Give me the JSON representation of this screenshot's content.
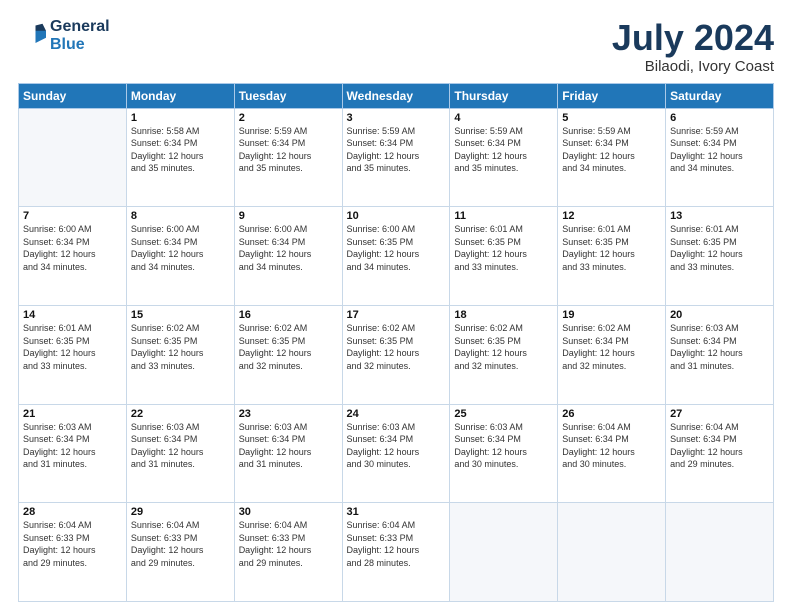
{
  "header": {
    "logo_line1": "General",
    "logo_line2": "Blue",
    "title": "July 2024",
    "subtitle": "Bilaodi, Ivory Coast"
  },
  "days_of_week": [
    "Sunday",
    "Monday",
    "Tuesday",
    "Wednesday",
    "Thursday",
    "Friday",
    "Saturday"
  ],
  "weeks": [
    [
      {
        "day": "",
        "info": ""
      },
      {
        "day": "1",
        "info": "Sunrise: 5:58 AM\nSunset: 6:34 PM\nDaylight: 12 hours\nand 35 minutes."
      },
      {
        "day": "2",
        "info": "Sunrise: 5:59 AM\nSunset: 6:34 PM\nDaylight: 12 hours\nand 35 minutes."
      },
      {
        "day": "3",
        "info": "Sunrise: 5:59 AM\nSunset: 6:34 PM\nDaylight: 12 hours\nand 35 minutes."
      },
      {
        "day": "4",
        "info": "Sunrise: 5:59 AM\nSunset: 6:34 PM\nDaylight: 12 hours\nand 35 minutes."
      },
      {
        "day": "5",
        "info": "Sunrise: 5:59 AM\nSunset: 6:34 PM\nDaylight: 12 hours\nand 34 minutes."
      },
      {
        "day": "6",
        "info": "Sunrise: 5:59 AM\nSunset: 6:34 PM\nDaylight: 12 hours\nand 34 minutes."
      }
    ],
    [
      {
        "day": "7",
        "info": "Sunrise: 6:00 AM\nSunset: 6:34 PM\nDaylight: 12 hours\nand 34 minutes."
      },
      {
        "day": "8",
        "info": "Sunrise: 6:00 AM\nSunset: 6:34 PM\nDaylight: 12 hours\nand 34 minutes."
      },
      {
        "day": "9",
        "info": "Sunrise: 6:00 AM\nSunset: 6:34 PM\nDaylight: 12 hours\nand 34 minutes."
      },
      {
        "day": "10",
        "info": "Sunrise: 6:00 AM\nSunset: 6:35 PM\nDaylight: 12 hours\nand 34 minutes."
      },
      {
        "day": "11",
        "info": "Sunrise: 6:01 AM\nSunset: 6:35 PM\nDaylight: 12 hours\nand 33 minutes."
      },
      {
        "day": "12",
        "info": "Sunrise: 6:01 AM\nSunset: 6:35 PM\nDaylight: 12 hours\nand 33 minutes."
      },
      {
        "day": "13",
        "info": "Sunrise: 6:01 AM\nSunset: 6:35 PM\nDaylight: 12 hours\nand 33 minutes."
      }
    ],
    [
      {
        "day": "14",
        "info": "Sunrise: 6:01 AM\nSunset: 6:35 PM\nDaylight: 12 hours\nand 33 minutes."
      },
      {
        "day": "15",
        "info": "Sunrise: 6:02 AM\nSunset: 6:35 PM\nDaylight: 12 hours\nand 33 minutes."
      },
      {
        "day": "16",
        "info": "Sunrise: 6:02 AM\nSunset: 6:35 PM\nDaylight: 12 hours\nand 32 minutes."
      },
      {
        "day": "17",
        "info": "Sunrise: 6:02 AM\nSunset: 6:35 PM\nDaylight: 12 hours\nand 32 minutes."
      },
      {
        "day": "18",
        "info": "Sunrise: 6:02 AM\nSunset: 6:35 PM\nDaylight: 12 hours\nand 32 minutes."
      },
      {
        "day": "19",
        "info": "Sunrise: 6:02 AM\nSunset: 6:34 PM\nDaylight: 12 hours\nand 32 minutes."
      },
      {
        "day": "20",
        "info": "Sunrise: 6:03 AM\nSunset: 6:34 PM\nDaylight: 12 hours\nand 31 minutes."
      }
    ],
    [
      {
        "day": "21",
        "info": "Sunrise: 6:03 AM\nSunset: 6:34 PM\nDaylight: 12 hours\nand 31 minutes."
      },
      {
        "day": "22",
        "info": "Sunrise: 6:03 AM\nSunset: 6:34 PM\nDaylight: 12 hours\nand 31 minutes."
      },
      {
        "day": "23",
        "info": "Sunrise: 6:03 AM\nSunset: 6:34 PM\nDaylight: 12 hours\nand 31 minutes."
      },
      {
        "day": "24",
        "info": "Sunrise: 6:03 AM\nSunset: 6:34 PM\nDaylight: 12 hours\nand 30 minutes."
      },
      {
        "day": "25",
        "info": "Sunrise: 6:03 AM\nSunset: 6:34 PM\nDaylight: 12 hours\nand 30 minutes."
      },
      {
        "day": "26",
        "info": "Sunrise: 6:04 AM\nSunset: 6:34 PM\nDaylight: 12 hours\nand 30 minutes."
      },
      {
        "day": "27",
        "info": "Sunrise: 6:04 AM\nSunset: 6:34 PM\nDaylight: 12 hours\nand 29 minutes."
      }
    ],
    [
      {
        "day": "28",
        "info": "Sunrise: 6:04 AM\nSunset: 6:33 PM\nDaylight: 12 hours\nand 29 minutes."
      },
      {
        "day": "29",
        "info": "Sunrise: 6:04 AM\nSunset: 6:33 PM\nDaylight: 12 hours\nand 29 minutes."
      },
      {
        "day": "30",
        "info": "Sunrise: 6:04 AM\nSunset: 6:33 PM\nDaylight: 12 hours\nand 29 minutes."
      },
      {
        "day": "31",
        "info": "Sunrise: 6:04 AM\nSunset: 6:33 PM\nDaylight: 12 hours\nand 28 minutes."
      },
      {
        "day": "",
        "info": ""
      },
      {
        "day": "",
        "info": ""
      },
      {
        "day": "",
        "info": ""
      }
    ]
  ]
}
